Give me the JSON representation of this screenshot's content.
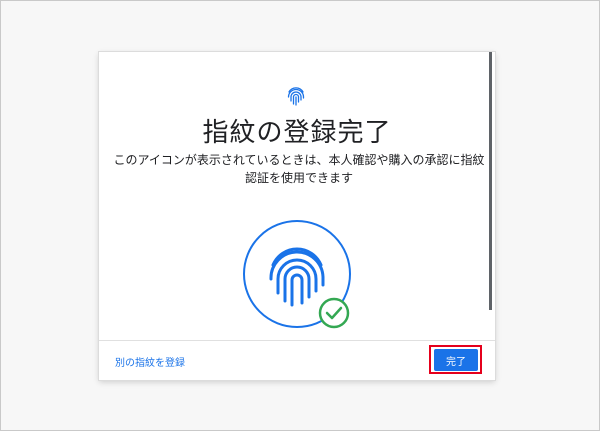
{
  "dialog": {
    "title": "指紋の登録完了",
    "description": "このアイコンが表示されているときは、本人確認や購入の承認に指紋認証を使用できます",
    "add_fingerprint_link": "別の指紋を登録",
    "done_button": "完了"
  },
  "icons": {
    "top": "fingerprint-icon",
    "illustration": "fingerprint-icon",
    "success": "check-circle-icon"
  },
  "colors": {
    "accent": "#1a73e8",
    "success": "#34a853",
    "highlight": "#e5001c"
  }
}
